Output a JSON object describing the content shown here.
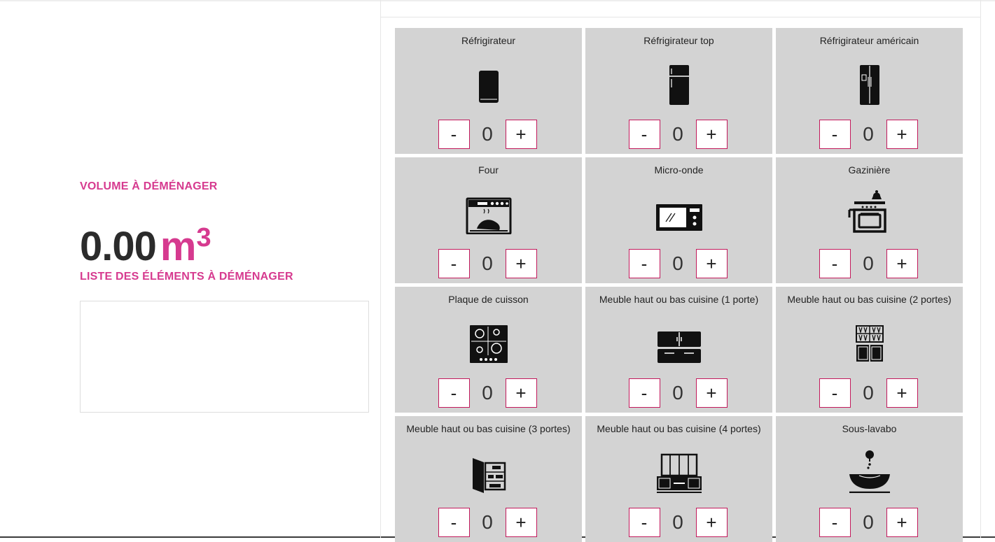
{
  "summary": {
    "volume_label": "VOLUME À DÉMÉNAGER",
    "volume_value": "0.00",
    "volume_unit": "m",
    "volume_unit_exp": "3",
    "list_label": "LISTE DES ÉLÉMENTS À DÉMÉNAGER"
  },
  "colors": {
    "accent": "#d63a8f",
    "card_bg": "#d3d3d3",
    "button_border": "#c2185b"
  },
  "items": [
    {
      "label": "Réfrigirateur",
      "count": "0",
      "minus": "-",
      "plus": "+",
      "icon": "fridge-icon"
    },
    {
      "label": "Réfrigirateur top",
      "count": "0",
      "minus": "-",
      "plus": "+",
      "icon": "fridge-top-icon"
    },
    {
      "label": "Réfrigirateur américain",
      "count": "0",
      "minus": "-",
      "plus": "+",
      "icon": "american-fridge-icon"
    },
    {
      "label": "Four",
      "count": "0",
      "minus": "-",
      "plus": "+",
      "icon": "oven-icon"
    },
    {
      "label": "Micro-onde",
      "count": "0",
      "minus": "-",
      "plus": "+",
      "icon": "microwave-icon"
    },
    {
      "label": "Gazinière",
      "count": "0",
      "minus": "-",
      "plus": "+",
      "icon": "gas-stove-icon"
    },
    {
      "label": "Plaque de cuisson",
      "count": "0",
      "minus": "-",
      "plus": "+",
      "icon": "cooktop-icon"
    },
    {
      "label": "Meuble haut ou bas cuisine (1 porte)",
      "count": "0",
      "minus": "-",
      "plus": "+",
      "icon": "kitchen-cabinet-1-icon"
    },
    {
      "label": "Meuble haut ou bas cuisine (2 portes)",
      "count": "0",
      "minus": "-",
      "plus": "+",
      "icon": "kitchen-cabinet-2-icon"
    },
    {
      "label": "Meuble haut ou bas cuisine (3 portes)",
      "count": "0",
      "minus": "-",
      "plus": "+",
      "icon": "kitchen-cabinet-3-icon"
    },
    {
      "label": "Meuble haut ou bas cuisine (4 portes)",
      "count": "0",
      "minus": "-",
      "plus": "+",
      "icon": "kitchen-cabinet-4-icon"
    },
    {
      "label": "Sous-lavabo",
      "count": "0",
      "minus": "-",
      "plus": "+",
      "icon": "sink-cabinet-icon"
    }
  ]
}
